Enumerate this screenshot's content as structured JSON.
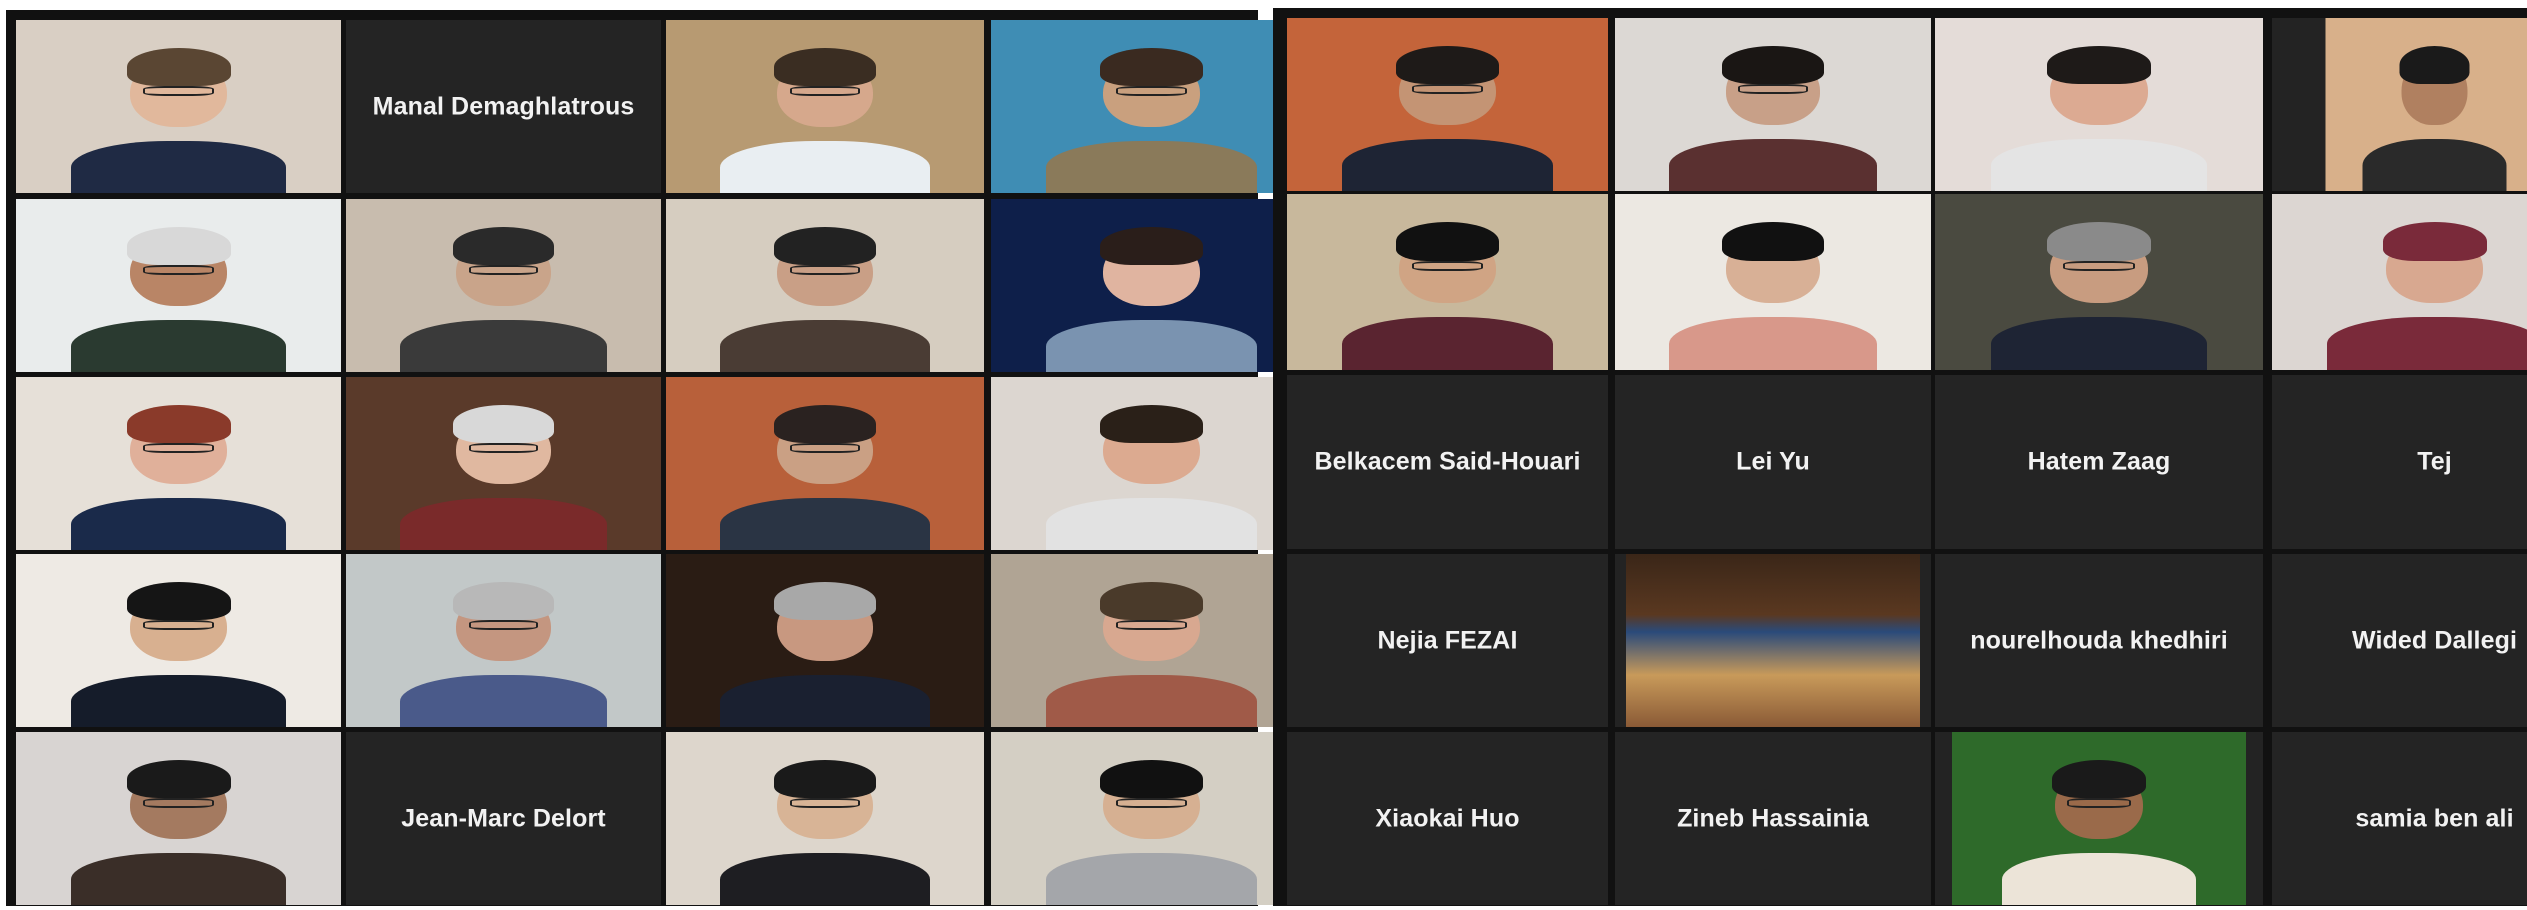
{
  "left_gallery": {
    "tiles": [
      {
        "kind": "video",
        "wall": "#d9cfc4",
        "skin": "#e1b89c",
        "hair": "#5a4633",
        "shirt": "#1f2a44",
        "glasses": true
      },
      {
        "kind": "name",
        "label": "Manal Demaghlatrous"
      },
      {
        "kind": "video",
        "wall": "#b79a72",
        "skin": "#d6a88c",
        "hair": "#3a2d22",
        "shirt": "#e9eef2",
        "glasses": true
      },
      {
        "kind": "video",
        "wall": "#3f8db4",
        "skin": "#c9a07e",
        "hair": "#3a2a20",
        "shirt": "#8a7a5a",
        "glasses": true
      },
      {
        "kind": "video",
        "wall": "#e9ecec",
        "skin": "#b98566",
        "hair": "#d8d8d8",
        "shirt": "#2a3a30",
        "glasses": true
      },
      {
        "kind": "video",
        "wall": "#c8bcae",
        "skin": "#c9a48a",
        "hair": "#2a2a2a",
        "shirt": "#3a3a3a",
        "glasses": true
      },
      {
        "kind": "video",
        "wall": "#d6cdc0",
        "skin": "#c99f86",
        "hair": "#222222",
        "shirt": "#4a3c34",
        "glasses": true
      },
      {
        "kind": "video",
        "wall": "#0e1f4a",
        "skin": "#e0b4a0",
        "hair": "#2a1e1a",
        "shirt": "#7a93b0",
        "glasses": false,
        "active": true
      },
      {
        "kind": "video",
        "wall": "#e6e0d8",
        "skin": "#e0b09a",
        "hair": "#8a3a2a",
        "shirt": "#1a2a4a",
        "glasses": true
      },
      {
        "kind": "video",
        "wall": "#5a3a2a",
        "skin": "#e0b8a0",
        "hair": "#d8d8d8",
        "shirt": "#7a2a2a",
        "glasses": true
      },
      {
        "kind": "video",
        "wall": "#b8603a",
        "skin": "#caa084",
        "hair": "#2a2220",
        "shirt": "#2a3444",
        "glasses": true
      },
      {
        "kind": "video",
        "wall": "#dcd6d0",
        "skin": "#dcaa90",
        "hair": "#2a2018",
        "shirt": "#e2e2e2",
        "glasses": false
      },
      {
        "kind": "video",
        "wall": "#eeeae4",
        "skin": "#d8b090",
        "hair": "#151515",
        "shirt": "#151c2a",
        "glasses": true
      },
      {
        "kind": "video",
        "wall": "#c2c8c8",
        "skin": "#c49680",
        "hair": "#b8b8b8",
        "shirt": "#4a5a8a",
        "glasses": true
      },
      {
        "kind": "video",
        "wall": "#2a1c14",
        "skin": "#c89880",
        "hair": "#a8a8a8",
        "shirt": "#1a2030",
        "glasses": false
      },
      {
        "kind": "video",
        "wall": "#b0a494",
        "skin": "#d8a890",
        "hair": "#4a3a2a",
        "shirt": "#a05a48",
        "glasses": true
      },
      {
        "kind": "video",
        "wall": "#d8d4d2",
        "skin": "#a47a60",
        "hair": "#1a1a1a",
        "shirt": "#3a2e28",
        "glasses": true
      },
      {
        "kind": "name",
        "label": "Jean-Marc Delort"
      },
      {
        "kind": "video",
        "wall": "#ddd6cc",
        "skin": "#d8b496",
        "hair": "#1a1a1a",
        "shirt": "#1e1e22",
        "glasses": true
      },
      {
        "kind": "video",
        "wall": "#d4cfc4",
        "skin": "#d6b092",
        "hair": "#111111",
        "shirt": "#a4a6aa",
        "glasses": true
      }
    ]
  },
  "right_gallery": {
    "tiles": [
      {
        "kind": "video",
        "wall": "#c4643a",
        "skin": "#c49474",
        "hair": "#1e1a18",
        "shirt": "#1e2434",
        "glasses": true
      },
      {
        "kind": "video",
        "wall": "#dcd8d4",
        "skin": "#c8a088",
        "hair": "#1a1614",
        "shirt": "#5a3030",
        "glasses": true
      },
      {
        "kind": "video",
        "wall": "#e4dcd8",
        "skin": "#dcaa92",
        "hair": "#1e1a18",
        "shirt": "#e4e4e4",
        "glasses": false
      },
      {
        "kind": "thumb",
        "width": 128,
        "wall": "#d8b08a",
        "skin": "#b08060",
        "hair": "#1a1a1a",
        "shirt": "#2a2a2a",
        "glasses": false
      },
      {
        "kind": "video",
        "wall": "#c8b89c",
        "skin": "#d0a484",
        "hair": "#111111",
        "shirt": "#5a2430",
        "glasses": true
      },
      {
        "kind": "video",
        "wall": "#ece8e2",
        "skin": "#d8b096",
        "hair": "#111111",
        "shirt": "#d8988a",
        "glasses": false
      },
      {
        "kind": "video",
        "wall": "#4a4a40",
        "skin": "#c89c80",
        "hair": "#8a8a8a",
        "shirt": "#1e2434",
        "glasses": true
      },
      {
        "kind": "video",
        "wall": "#dcd6d2",
        "skin": "#d8a890",
        "hair": "#7a2a3a",
        "shirt": "#7a2a3a",
        "glasses": false
      },
      {
        "kind": "name",
        "label": "Belkacem Said-Houari"
      },
      {
        "kind": "name",
        "label": "Lei Yu"
      },
      {
        "kind": "name",
        "label": "Hatem Zaag"
      },
      {
        "kind": "name",
        "label": "Tej"
      },
      {
        "kind": "name",
        "label": "Nejia FEZAI"
      },
      {
        "kind": "hall",
        "width": 172
      },
      {
        "kind": "name",
        "label": "nourelhouda khedhiri"
      },
      {
        "kind": "name",
        "label": "Wided Dallegi"
      },
      {
        "kind": "name",
        "label": "Xiaokai Huo"
      },
      {
        "kind": "name",
        "label": "Zineb Hassainia"
      },
      {
        "kind": "thumb",
        "width": 172,
        "wall": "#2e6a2a",
        "skin": "#9a6a4a",
        "hair": "#1a1a1a",
        "shirt": "#ece4d8",
        "glasses": true
      },
      {
        "kind": "name",
        "label": "samia ben ali"
      }
    ]
  }
}
